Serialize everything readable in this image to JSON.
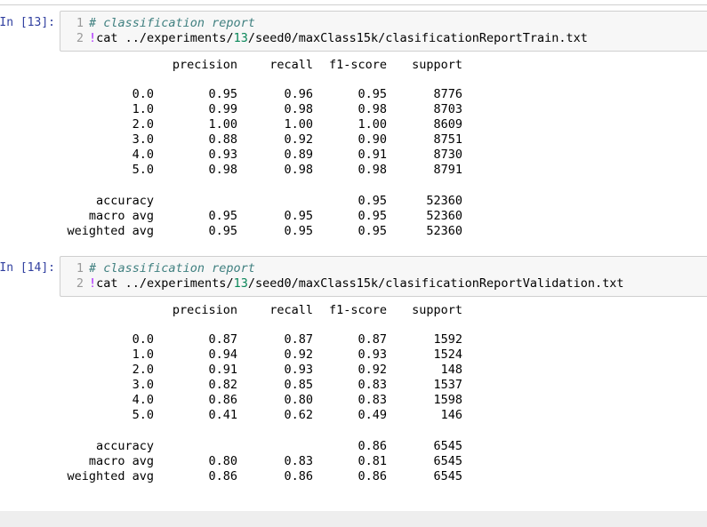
{
  "cells": [
    {
      "prompt": "In [13]:",
      "code": [
        {
          "n": "1",
          "comment": "# classification report"
        },
        {
          "n": "2",
          "bang": "!",
          "pre": "cat ../experiments/",
          "num": "13",
          "post": "/seed0/maxClass15k/clasificationReportTrain.txt"
        }
      ],
      "headers": [
        "precision",
        "recall",
        "f1-score",
        "support"
      ],
      "rows": [
        [
          "0.0",
          "0.95",
          "0.96",
          "0.95",
          "8776"
        ],
        [
          "1.0",
          "0.99",
          "0.98",
          "0.98",
          "8703"
        ],
        [
          "2.0",
          "1.00",
          "1.00",
          "1.00",
          "8609"
        ],
        [
          "3.0",
          "0.88",
          "0.92",
          "0.90",
          "8751"
        ],
        [
          "4.0",
          "0.93",
          "0.89",
          "0.91",
          "8730"
        ],
        [
          "5.0",
          "0.98",
          "0.98",
          "0.98",
          "8791"
        ]
      ],
      "summary": [
        [
          "accuracy",
          "",
          "",
          "0.95",
          "52360"
        ],
        [
          "macro avg",
          "0.95",
          "0.95",
          "0.95",
          "52360"
        ],
        [
          "weighted avg",
          "0.95",
          "0.95",
          "0.95",
          "52360"
        ]
      ]
    },
    {
      "prompt": "In [14]:",
      "code": [
        {
          "n": "1",
          "comment": "# classification report"
        },
        {
          "n": "2",
          "bang": "!",
          "pre": "cat ../experiments/",
          "num": "13",
          "post": "/seed0/maxClass15k/clasificationReportValidation.txt"
        }
      ],
      "headers": [
        "precision",
        "recall",
        "f1-score",
        "support"
      ],
      "rows": [
        [
          "0.0",
          "0.87",
          "0.87",
          "0.87",
          "1592"
        ],
        [
          "1.0",
          "0.94",
          "0.92",
          "0.93",
          "1524"
        ],
        [
          "2.0",
          "0.91",
          "0.93",
          "0.92",
          "148"
        ],
        [
          "3.0",
          "0.82",
          "0.85",
          "0.83",
          "1537"
        ],
        [
          "4.0",
          "0.86",
          "0.80",
          "0.83",
          "1598"
        ],
        [
          "5.0",
          "0.41",
          "0.62",
          "0.49",
          "146"
        ]
      ],
      "summary": [
        [
          "accuracy",
          "",
          "",
          "0.86",
          "6545"
        ],
        [
          "macro avg",
          "0.80",
          "0.83",
          "0.81",
          "6545"
        ],
        [
          "weighted avg",
          "0.86",
          "0.86",
          "0.86",
          "6545"
        ]
      ]
    }
  ]
}
